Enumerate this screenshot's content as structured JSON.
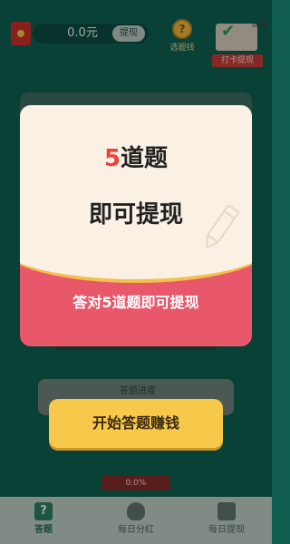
{
  "topbar": {
    "balance": "0.0元",
    "withdraw_label": "提现",
    "coin_glyph": "?",
    "coin_label": "选题钱",
    "checkin_count": "0/30",
    "checkin_label": "打卡提现"
  },
  "background": {
    "panel_text": "答题进度"
  },
  "modal": {
    "headline_num": "5",
    "headline_rest": "道题",
    "headline_line2": "即可提现",
    "subtitle": "答对5道题即可提现"
  },
  "cta_label": "开始答题赚钱",
  "progress": {
    "label": "0.0%",
    "fraction": 0.0
  },
  "nav": {
    "items": [
      {
        "label": "答题",
        "icon": "question-icon"
      },
      {
        "label": "每日分红",
        "icon": "money-bag-icon"
      },
      {
        "label": "每日提现",
        "icon": "wallet-icon"
      }
    ]
  },
  "colors": {
    "background": "#0f5e50",
    "modal_cream": "#fbf0e4",
    "modal_pink": "#e8586a",
    "accent_red": "#e8443d",
    "gold": "#f6c94a"
  }
}
